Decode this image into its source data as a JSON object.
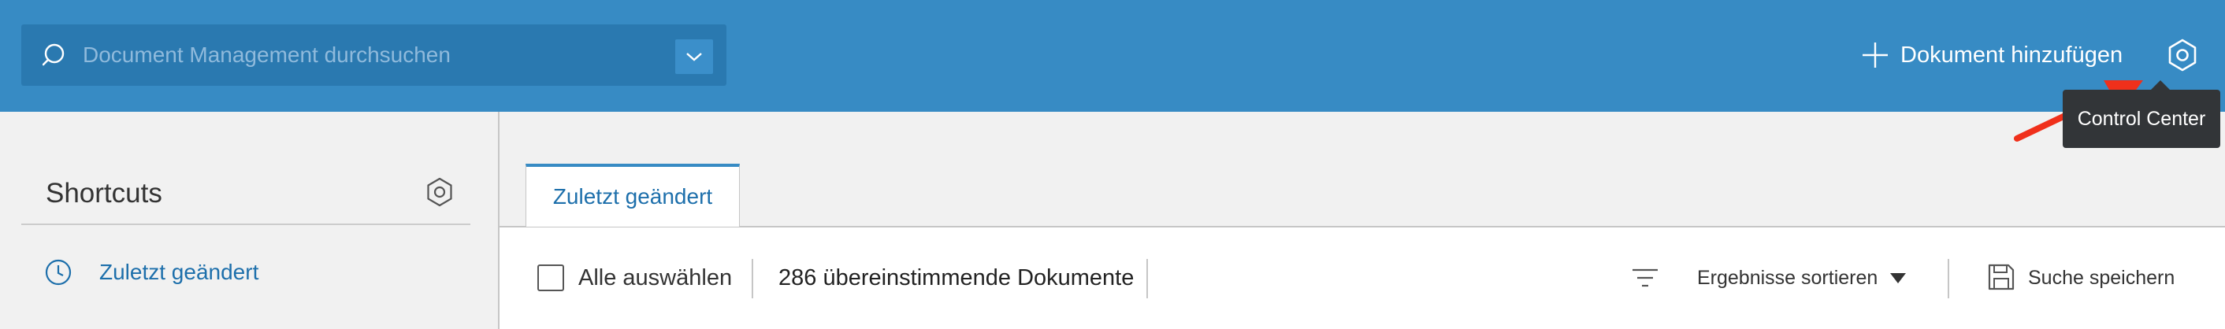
{
  "header": {
    "search": {
      "placeholder": "Document Management durchsuchen",
      "icon": "search-icon",
      "dropdown_icon": "chevron-down-icon"
    },
    "add_document_label": "Dokument hinzufügen",
    "settings_icon": "gear-icon",
    "tooltip": "Control Center"
  },
  "sidebar": {
    "title": "Shortcuts",
    "items": [
      {
        "label": "Zuletzt geändert",
        "icon": "clock-icon"
      }
    ]
  },
  "main": {
    "tabs": [
      {
        "label": "Zuletzt geändert",
        "active": true
      }
    ],
    "toolbar": {
      "select_all_label": "Alle auswählen",
      "result_count": "286 übereinstimmende Dokumente",
      "sort_label": "Ergebnisse sortieren",
      "save_search_label": "Suche speichern"
    }
  },
  "colors": {
    "header_bg": "#378bc4",
    "search_bg": "#2a79b0",
    "link": "#1d6fab",
    "tooltip_bg": "#323538",
    "annotation_arrow": "#f0301b"
  }
}
